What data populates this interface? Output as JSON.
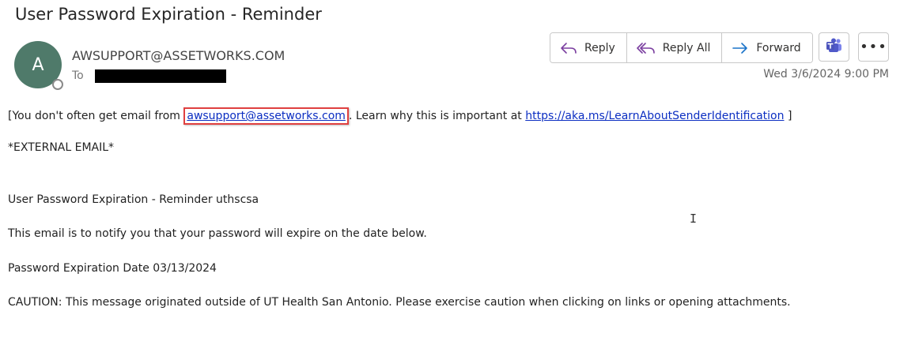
{
  "email": {
    "subject": "User Password Expiration - Reminder",
    "avatar_letter": "A",
    "sender": "AWSUPPORT@ASSETWORKS.COM",
    "to_label": "To",
    "date": "Wed 3/6/2024 9:00 PM"
  },
  "actions": {
    "reply": "Reply",
    "reply_all": "Reply All",
    "forward": "Forward",
    "more": "•••"
  },
  "body": {
    "notice_prefix": "[You don't often get email from ",
    "notice_email": "awsupport@assetworks.com",
    "notice_middle": ". Learn why this is important at ",
    "notice_link": "https://aka.ms/LearnAboutSenderIdentification",
    "notice_suffix": " ]",
    "external": "*EXTERNAL EMAIL*",
    "line1": "User Password Expiration - Reminder uthscsa",
    "line2": "This email is to notify you that your password will expire on the date below.",
    "line3": "Password Expiration Date 03/13/2024",
    "line4": "CAUTION: This message originated outside of UT Health San Antonio. Please exercise caution when clicking on links or opening attachments."
  },
  "colors": {
    "avatar": "#4f7a6a",
    "link": "#0b2ec2",
    "highlight": "#e04040",
    "action_icon": "#7b3fa0",
    "forward_icon": "#1a73c9",
    "teams": "#5059c9"
  }
}
